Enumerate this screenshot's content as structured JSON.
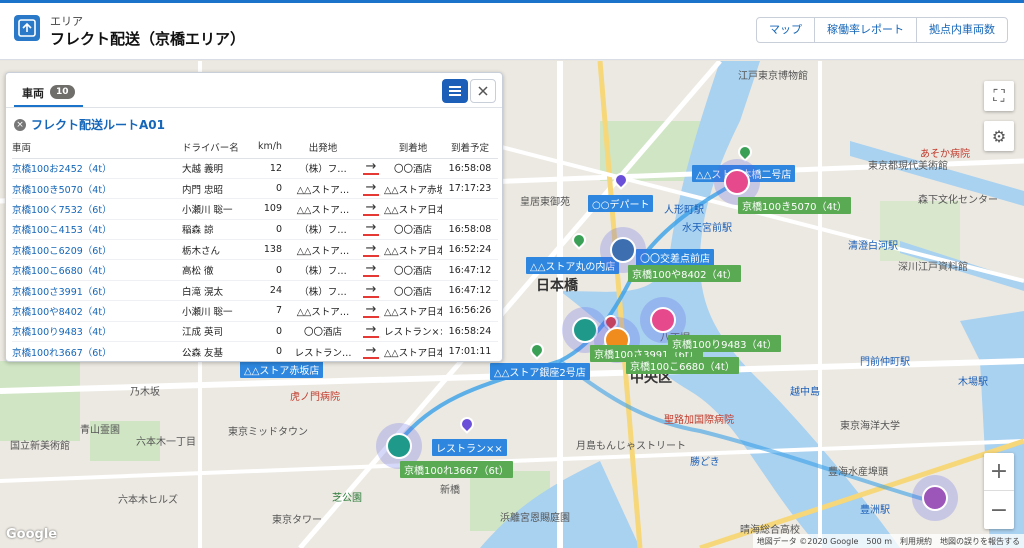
{
  "header": {
    "subtitle": "エリア",
    "title": "フレクト配送（京橋エリア）",
    "buttons": [
      "マップ",
      "稼働率レポート",
      "拠点内車両数"
    ]
  },
  "panel": {
    "tab_label": "車両",
    "tab_count": "10",
    "route_name": "フレクト配送ルートA01",
    "columns": [
      "車両",
      "ドライバー名",
      "km/h",
      "出発地",
      "",
      "到着地",
      "到着予定"
    ],
    "rows": [
      {
        "vehicle": "京橋100お2452（4t）",
        "driver": "大越 義明",
        "speed": "12",
        "from": "（株）フ…",
        "to": "〇〇酒店",
        "eta": "16:58:08"
      },
      {
        "vehicle": "京橋100き5070（4t）",
        "driver": "内門 忠昭",
        "speed": "0",
        "from": "△△ストア…",
        "to": "△△ストア赤坂",
        "eta": "17:17:23"
      },
      {
        "vehicle": "京橋100く7532（6t）",
        "driver": "小瀬川 聡一",
        "speed": "109",
        "from": "△△ストア…",
        "to": "△△ストア日本橋",
        "eta": ""
      },
      {
        "vehicle": "京橋100こ4153（4t）",
        "driver": "稲森 諒",
        "speed": "0",
        "from": "（株）フ…",
        "to": "〇〇酒店",
        "eta": "16:58:08"
      },
      {
        "vehicle": "京橋100こ6209（6t）",
        "driver": "栃木さん",
        "speed": "138",
        "from": "△△ストア…",
        "to": "△△ストア日本橋",
        "eta": "16:52:24"
      },
      {
        "vehicle": "京橋100こ6680（4t）",
        "driver": "高松 徹",
        "speed": "0",
        "from": "（株）フ…",
        "to": "〇〇酒店",
        "eta": "16:47:12"
      },
      {
        "vehicle": "京橋100さ3991（6t）",
        "driver": "白滝 滉太",
        "speed": "24",
        "from": "（株）フ…",
        "to": "〇〇酒店",
        "eta": "16:47:12"
      },
      {
        "vehicle": "京橋100や8402（4t）",
        "driver": "小瀬川 聡一",
        "speed": "7",
        "from": "△△ストア…",
        "to": "△△ストア日本橋",
        "eta": "16:56:26"
      },
      {
        "vehicle": "京橋100り9483（4t）",
        "driver": "江成 英司",
        "speed": "0",
        "from": "〇〇酒店",
        "to": "レストラン××",
        "eta": "16:58:24"
      },
      {
        "vehicle": "京橋100れ3667（6t）",
        "driver": "公森 友基",
        "speed": "0",
        "from": "レストラン…",
        "to": "△△ストア日本橋",
        "eta": "17:01:11"
      }
    ],
    "arrow_glyph": "→"
  },
  "map": {
    "vehicle_labels": [
      "京橋100き5070（4t）",
      "京橋100や8402（4t）",
      "京橋100さ3991（6t）",
      "京橋100り9483（4t）",
      "京橋100こ6680（4t）",
      "京橋100れ3667（6t）"
    ],
    "store_labels": [
      "△△ストア本橋二号店",
      "○○デパート",
      "△△ストア丸の内店",
      "〇〇交差点前店",
      "△△ストア銀座2号店",
      "△△ストア赤坂店",
      "レストラン××"
    ],
    "place_labels": [
      "江戸東京博物館",
      "日本橋",
      "中央区",
      "八丁堀",
      "人形町駅",
      "水天宮前駅",
      "東京ミッドタウン",
      "六本木ヒルズ",
      "虎ノ門病院",
      "聖路加国際病院",
      "月島もんじゃストリート",
      "東京タワー",
      "門前仲町駅",
      "豊洲駅",
      "清澄白河駅",
      "深川江戸資料館",
      "木場駅",
      "浜離宮恩賜庭園",
      "新橋",
      "東京都現代美術館",
      "皇居東御苑",
      "六本木一丁目",
      "青山霊園",
      "国立新美術館",
      "乃木坂",
      "芝公園",
      "あそか病院",
      "森下文化センター",
      "勝どき",
      "晴海総合高校",
      "東京海洋大学",
      "越中島",
      "豊海水産埠頭"
    ],
    "zoom_in": "+",
    "zoom_out": "−",
    "fullscreen_icon": "⛶",
    "settings_icon": "⚙",
    "attribution": [
      "地図データ ©2020 Google",
      "500 m",
      "利用規約",
      "地図の誤りを報告する"
    ],
    "google_logo": "Google"
  },
  "colors": {
    "brand": "#1b74c9",
    "vehicle_pink": "#e64a8c",
    "vehicle_blue": "#3d6fb0",
    "vehicle_teal": "#1f9a8a",
    "vehicle_orange": "#f08c1e",
    "vehicle_purple": "#9c55b8",
    "label_green": "#5aa953",
    "label_blue": "#2e86de"
  }
}
